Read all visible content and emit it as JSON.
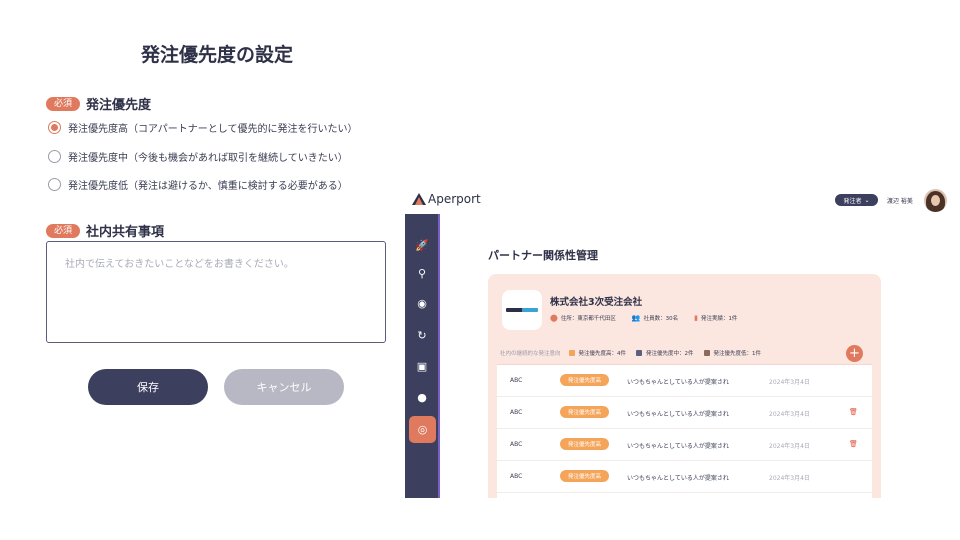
{
  "form": {
    "title": "発注優先度の設定",
    "required_badge": "必須",
    "priority_section": "発注優先度",
    "options": [
      {
        "label": "発注優先度高（コアパートナーとして優先的に発注を行いたい）",
        "checked": true
      },
      {
        "label": "発注優先度中（今後も機会があれば取引を継続していきたい）",
        "checked": false
      },
      {
        "label": "発注優先度低（発注は避けるか、慎重に検討する必要がある）",
        "checked": false
      }
    ],
    "memo_section": "社内共有事項",
    "memo_placeholder": "社内で伝えておきたいことなどをお書きください。",
    "save_label": "保存",
    "cancel_label": "キャンセル"
  },
  "app": {
    "brand": "Aperport",
    "role": "発注者",
    "user_name": "渡辺 裕美",
    "page_title": "パートナー関係性管理",
    "company": {
      "name": "株式会社3次受注会社",
      "address": "住所：東京都千代田区",
      "employees": "社員数：30名",
      "orders": "発注実績：1件"
    },
    "list": {
      "hint": "社内の継続的な発注意向",
      "legend": [
        {
          "label": "発注優先度高：4件",
          "color": "#f5a55a"
        },
        {
          "label": "発注優先度中：2件",
          "color": "#5a6080"
        },
        {
          "label": "発注優先度低：1件",
          "color": "#8a6a5a"
        }
      ],
      "add": "+",
      "rows": [
        {
          "name": "ABC",
          "tag": "発注優先度高",
          "message": "いつもちゃんとしている人が提案され",
          "date": "2024年3月4日",
          "trash": false
        },
        {
          "name": "ABC",
          "tag": "発注優先度高",
          "message": "いつもちゃんとしている人が提案され",
          "date": "2024年3月4日",
          "trash": true
        },
        {
          "name": "ABC",
          "tag": "発注優先度高",
          "message": "いつもちゃんとしている人が提案され",
          "date": "2024年3月4日",
          "trash": true
        },
        {
          "name": "ABC",
          "tag": "発注優先度高",
          "message": "いつもちゃんとしている人が提案され",
          "date": "2024年3月4日",
          "trash": false
        }
      ]
    },
    "sidebar_icons": [
      "rocket-icon",
      "search-icon",
      "chat-search-icon",
      "refresh-icon",
      "card-icon",
      "message-icon",
      "eye-icon"
    ]
  }
}
